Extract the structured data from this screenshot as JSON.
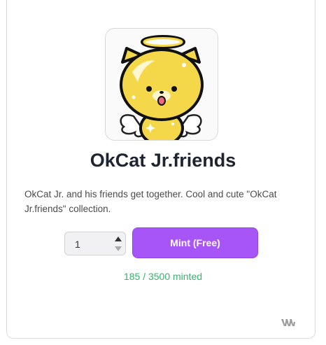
{
  "collection": {
    "title": "OkCat Jr.friends",
    "description": "OkCat Jr. and his friends get together. Cool and cute \"OkCat Jr.friends\" collection."
  },
  "mint": {
    "quantity": "1",
    "button_label": "Mint (Free)",
    "status": "185 / 3500 minted",
    "minted": 185,
    "supply": 3500
  },
  "colors": {
    "button": "#a855f7",
    "minted_text": "#33b36b",
    "title_text": "#1f2433"
  },
  "icons": {
    "nft": "okcat-angel-image",
    "stepper_up": "triangle-up-icon",
    "stepper_down": "triangle-down-icon",
    "brand": "brand-logo-icon"
  }
}
